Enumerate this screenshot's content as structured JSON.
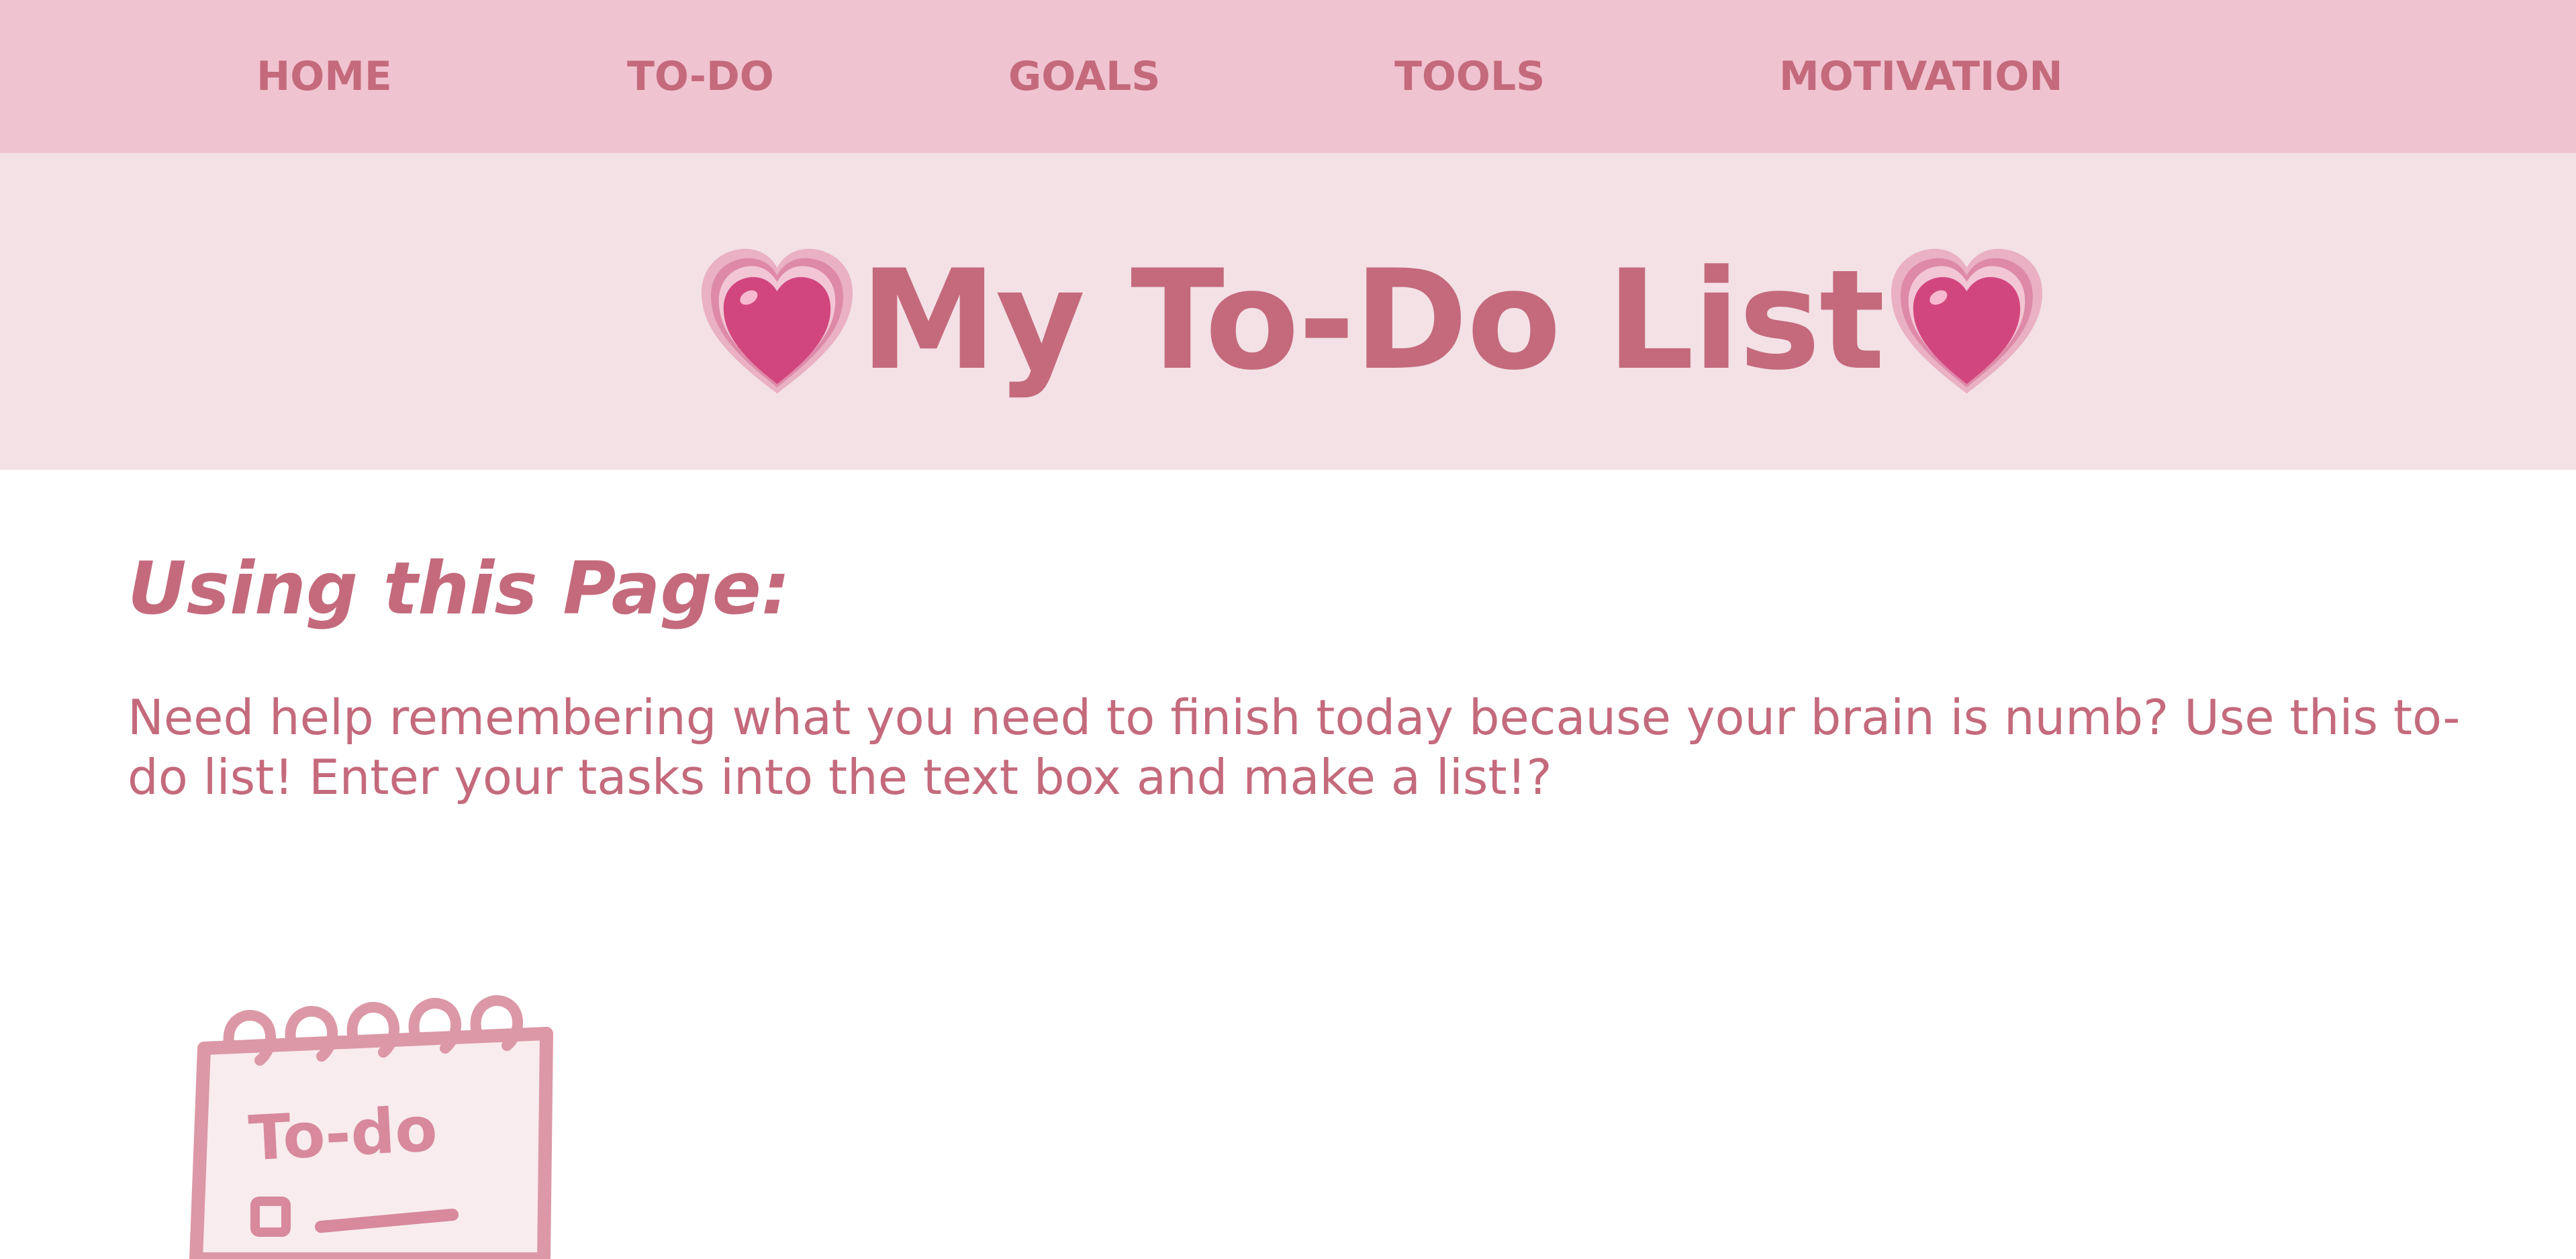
{
  "nav": {
    "items": [
      {
        "label": "HOME"
      },
      {
        "label": "TO-DO"
      },
      {
        "label": "GOALS"
      },
      {
        "label": "TOOLS"
      },
      {
        "label": "MOTIVATION"
      }
    ]
  },
  "header": {
    "title": "My To-Do List",
    "left_icon": "growing-heart-icon",
    "right_icon": "growing-heart-icon"
  },
  "main": {
    "heading": "Using this Page:",
    "description": "Need help remembering what you need to finish today because your brain is numb? Use this to-do list! Enter your tasks into the text box and make a list!?",
    "notepad": {
      "icon": "notepad-icon",
      "label": "To-do"
    }
  },
  "colors": {
    "nav_bg": "#f0c3d0",
    "header_bg": "#f3e1e6",
    "text": "#c46a7c",
    "heart": "#d2467e"
  }
}
